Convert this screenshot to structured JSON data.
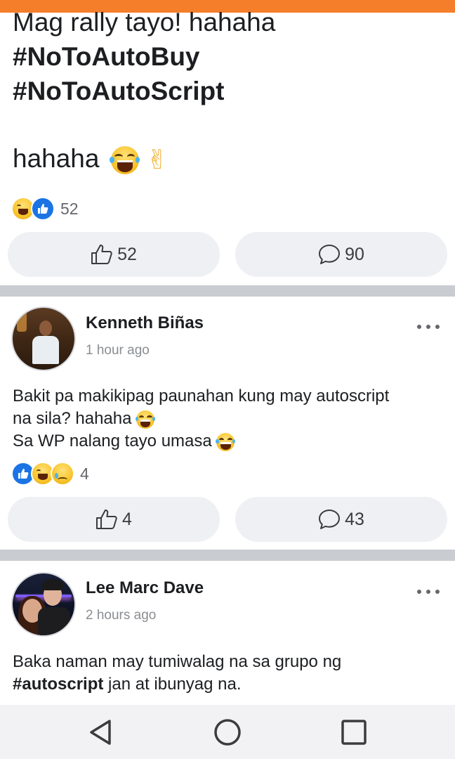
{
  "post1": {
    "line1": "Mag rally tayo! hahaha",
    "line2": "#NoToAutoBuy",
    "line3": "#NoToAutoScript",
    "line4": "hahaha",
    "reaction_count": "52",
    "like_count": "52",
    "comment_count": "90"
  },
  "post2": {
    "author": "Kenneth Biñas",
    "time": "1 hour ago",
    "line1": "Bakit pa makikipag paunahan kung may autoscript",
    "line2": "na sila? hahaha",
    "line3": "Sa WP nalang tayo umasa",
    "reaction_count": "4",
    "like_count": "4",
    "comment_count": "43"
  },
  "post3": {
    "author": "Lee Marc Dave",
    "time": "2 hours ago",
    "line1": "Baka naman may tumiwalag na sa grupo ng",
    "line2_hashtag": "#autoscript",
    "line2_rest": " jan at ibunyag na."
  },
  "icons": {
    "top_bar_color": "#f57e2a",
    "like": "like-icon",
    "comment": "comment-icon",
    "more": "more-icon",
    "nav_back": "back-triangle-icon",
    "nav_home": "home-circle-icon",
    "nav_recent": "recent-square-icon"
  }
}
